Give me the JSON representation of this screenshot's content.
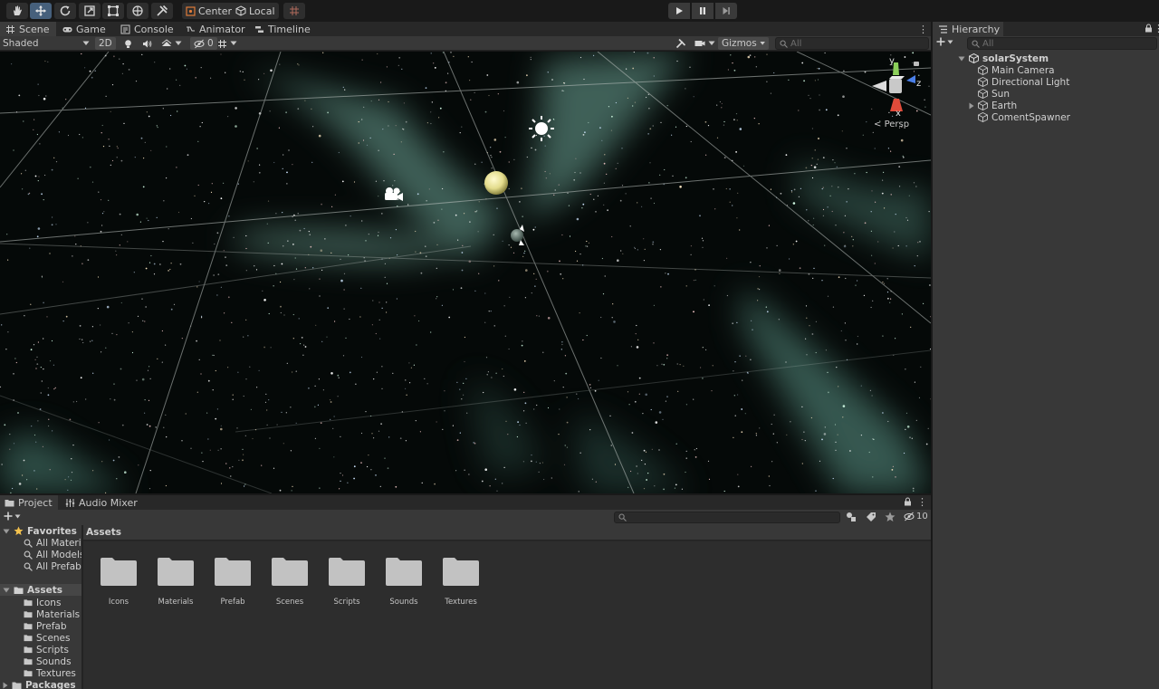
{
  "toolbar": {
    "tools": [
      "hand-tool",
      "move-tool",
      "rotate-tool",
      "scale-tool",
      "rect-tool",
      "transform-tool",
      "custom-tool"
    ],
    "pivot_label": "Center",
    "space_label": "Local"
  },
  "scene_tabs": [
    {
      "label": "Scene",
      "icon": "grid-icon"
    },
    {
      "label": "Game",
      "icon": "gamepad-icon"
    },
    {
      "label": "Console",
      "icon": "console-icon"
    },
    {
      "label": "Animator",
      "icon": "animator-icon"
    },
    {
      "label": "Timeline",
      "icon": "timeline-icon"
    }
  ],
  "scene_toolbar": {
    "draw_mode": "Shaded",
    "mode_2d": "2D",
    "hidden_count": "0",
    "gizmos_label": "Gizmos",
    "search_placeholder": "All"
  },
  "viewport": {
    "projection_label": "Persp",
    "axis_labels": {
      "y": "y",
      "z": "z",
      "x": "x"
    },
    "colors": {
      "sky": "#050908",
      "nebula": "#6fa89a",
      "sun": "#e8e29a",
      "grid": "#bfc5c2"
    }
  },
  "hierarchy": {
    "tab_label": "Hierarchy",
    "search_placeholder": "All",
    "scene_name": "solarSystem",
    "items": [
      "Main Camera",
      "Directional Light",
      "Sun",
      "Earth",
      "ComentSpawner"
    ]
  },
  "project": {
    "tabs": [
      "Project",
      "Audio Mixer"
    ],
    "hidden_count": "10",
    "breadcrumb": "Assets",
    "favorites_label": "Favorites",
    "favorites": [
      "All Materia",
      "All Models",
      "All Prefabs"
    ],
    "assets_label": "Assets",
    "asset_folders": [
      "Icons",
      "Materials",
      "Prefab",
      "Scenes",
      "Scripts",
      "Sounds",
      "Textures"
    ],
    "packages_label": "Packages"
  }
}
